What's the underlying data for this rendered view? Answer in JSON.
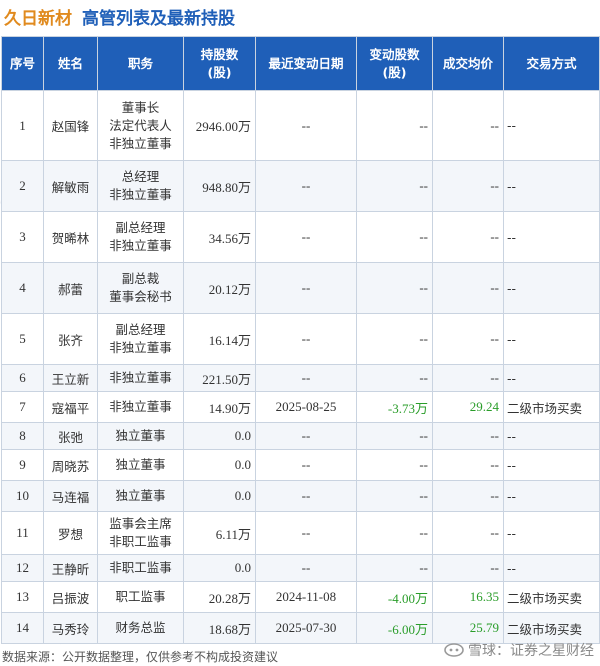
{
  "header": {
    "company": "久日新材",
    "title": "高管列表及最新持股"
  },
  "table": {
    "columns": [
      "序号",
      "姓名",
      "职务",
      "持股数\n(股)",
      "最近变动日期",
      "变动股数\n(股)",
      "成交均价",
      "交易方式"
    ],
    "rows": [
      {
        "seq": "1",
        "name": "赵国锋",
        "role": [
          "董事长",
          "法定代表人",
          "非独立董事"
        ],
        "holding": "2946.00万",
        "date": "--",
        "change": "--",
        "price": "--",
        "method": "--"
      },
      {
        "seq": "2",
        "name": "解敏雨",
        "role": [
          "总经理",
          "非独立董事"
        ],
        "holding": "948.80万",
        "date": "--",
        "change": "--",
        "price": "--",
        "method": "--"
      },
      {
        "seq": "3",
        "name": "贺晞林",
        "role": [
          "副总经理",
          "非独立董事"
        ],
        "holding": "34.56万",
        "date": "--",
        "change": "--",
        "price": "--",
        "method": "--"
      },
      {
        "seq": "4",
        "name": "郝蕾",
        "role": [
          "副总裁",
          "董事会秘书"
        ],
        "holding": "20.12万",
        "date": "--",
        "change": "--",
        "price": "--",
        "method": "--"
      },
      {
        "seq": "5",
        "name": "张齐",
        "role": [
          "副总经理",
          "非独立董事"
        ],
        "holding": "16.14万",
        "date": "--",
        "change": "--",
        "price": "--",
        "method": "--"
      },
      {
        "seq": "6",
        "name": "王立新",
        "role": [
          "非独立董事"
        ],
        "holding": "221.50万",
        "date": "--",
        "change": "--",
        "price": "--",
        "method": "--"
      },
      {
        "seq": "7",
        "name": "寇福平",
        "role": [
          "非独立董事"
        ],
        "holding": "14.90万",
        "date": "2025-08-25",
        "change": "-3.73万",
        "price": "29.24",
        "method": "二级市场买卖"
      },
      {
        "seq": "8",
        "name": "张弛",
        "role": [
          "独立董事"
        ],
        "holding": "0.0",
        "date": "--",
        "change": "--",
        "price": "--",
        "method": "--"
      },
      {
        "seq": "9",
        "name": "周晓苏",
        "role": [
          "独立董事"
        ],
        "holding": "0.0",
        "date": "--",
        "change": "--",
        "price": "--",
        "method": "--"
      },
      {
        "seq": "10",
        "name": "马连福",
        "role": [
          "独立董事"
        ],
        "holding": "0.0",
        "date": "--",
        "change": "--",
        "price": "--",
        "method": "--"
      },
      {
        "seq": "11",
        "name": "罗想",
        "role": [
          "监事会主席",
          "非职工监事"
        ],
        "holding": "6.11万",
        "date": "--",
        "change": "--",
        "price": "--",
        "method": "--"
      },
      {
        "seq": "12",
        "name": "王静昕",
        "role": [
          "非职工监事"
        ],
        "holding": "0.0",
        "date": "--",
        "change": "--",
        "price": "--",
        "method": "--"
      },
      {
        "seq": "13",
        "name": "吕振波",
        "role": [
          "职工监事"
        ],
        "holding": "20.28万",
        "date": "2024-11-08",
        "change": "-4.00万",
        "price": "16.35",
        "method": "二级市场买卖"
      },
      {
        "seq": "14",
        "name": "马秀玲",
        "role": [
          "财务总监"
        ],
        "holding": "18.68万",
        "date": "2025-07-30",
        "change": "-6.00万",
        "price": "25.79",
        "method": "二级市场买卖"
      }
    ]
  },
  "footer": {
    "source": "数据来源：公开数据整理，仅供参考不构成投资建议",
    "brand": "雪球：证券之星财经"
  },
  "watermark": "证券之星",
  "colors": {
    "header_bg": "#1f5fb8",
    "company": "#e08a1e",
    "title": "#1f5fb8",
    "change": "#2a9d2a"
  }
}
